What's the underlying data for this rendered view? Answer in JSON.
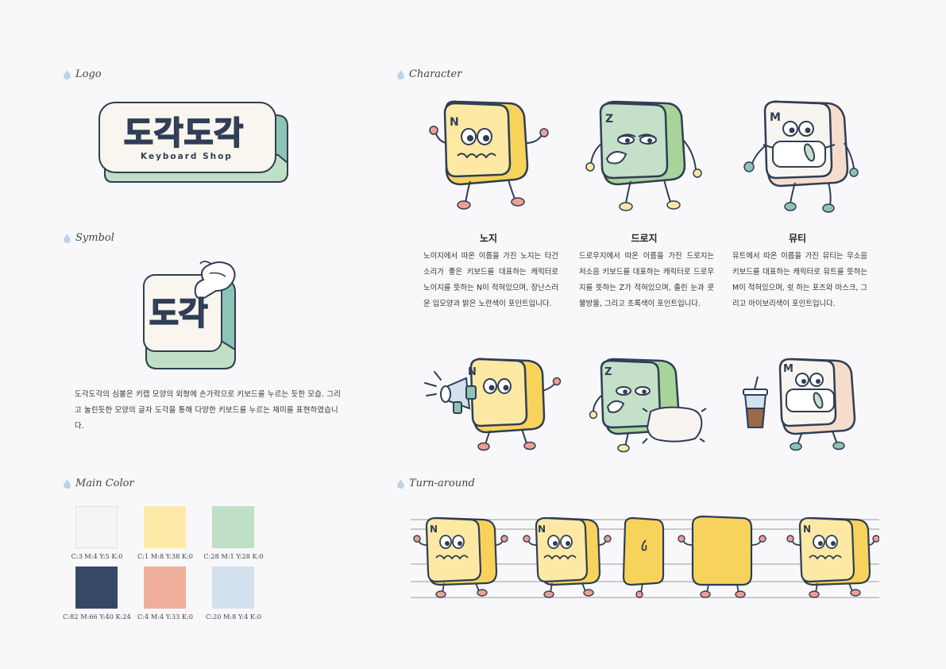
{
  "sections": {
    "logo": "Logo",
    "symbol": "Symbol",
    "main_color": "Main Color",
    "character": "Character",
    "turnaround": "Turn-around"
  },
  "logo": {
    "wordmark": "도각도각",
    "subtitle": "Keyboard Shop"
  },
  "symbol": {
    "glyph": "도각",
    "description": "도각도각의 심볼은 키캡 모양의 외형에 손가락으로 키보드를 누르는 듯한 모습. 그리고 눌린듯한 모양의 글자 도각을 통해 다양한 키보드를 누르는 재미를 표현하였습니다."
  },
  "colors": [
    {
      "label": "C:3 M:4 Y:5 K:0",
      "hex": "#f7f5f3"
    },
    {
      "label": "C:1 M:8 Y:38 K:0",
      "hex": "#fdeaa9"
    },
    {
      "label": "C:28 M:1 Y:28 K:0",
      "hex": "#bfe0c6"
    },
    {
      "label": "C:82 M:66 Y:40 K:24",
      "hex": "#364867"
    },
    {
      "label": "C:4 M:4 Y:33 K:0",
      "hex": "#efad9c"
    },
    {
      "label": "C:20 M:8 Y:4 K:0",
      "hex": "#d3e0ed"
    }
  ],
  "characters": [
    {
      "name": "노지",
      "letter": "N",
      "description": "노이지에서 따온 이름을 가진 노지는 타건 소리가 좋은 키보드를 대표하는 캐릭터로 노이지를 뜻하는 N이 적혀있으며, 장난스러운 입모양과 밝은 노란색이 포인트입니다."
    },
    {
      "name": "드로지",
      "letter": "Z",
      "description": "드로우지에서 따온 이름을 가진 드로지는 저소음 키보드를 대표하는 캐릭터로 드로우지를 뜻하는 Z가 적혀있으며, 졸린 눈과 콧물방울, 그리고 초록색이 포인트입니다."
    },
    {
      "name": "뮤티",
      "letter": "M",
      "description": "뮤트에서 따온 이름을 가진 뮤티는 무소음 키보드를 대표하는 캐릭터로 뮤트를 뜻하는 M이 적혀있으며, 쉿 하는 포즈와 마스크, 그리고 아이보리색이 포인트입니다."
    }
  ],
  "palette": {
    "outline": "#2f3e55",
    "yellow_dark": "#f7d35c",
    "yellow_light": "#fde9a4",
    "green_dark": "#a8d49a",
    "green_light": "#c4e0c9",
    "ivory": "#f8f5f0",
    "peach": "#f5dccb",
    "pink": "#ef9e94",
    "teal": "#8cc4b6",
    "logo_yellow": "#fbe79b"
  }
}
